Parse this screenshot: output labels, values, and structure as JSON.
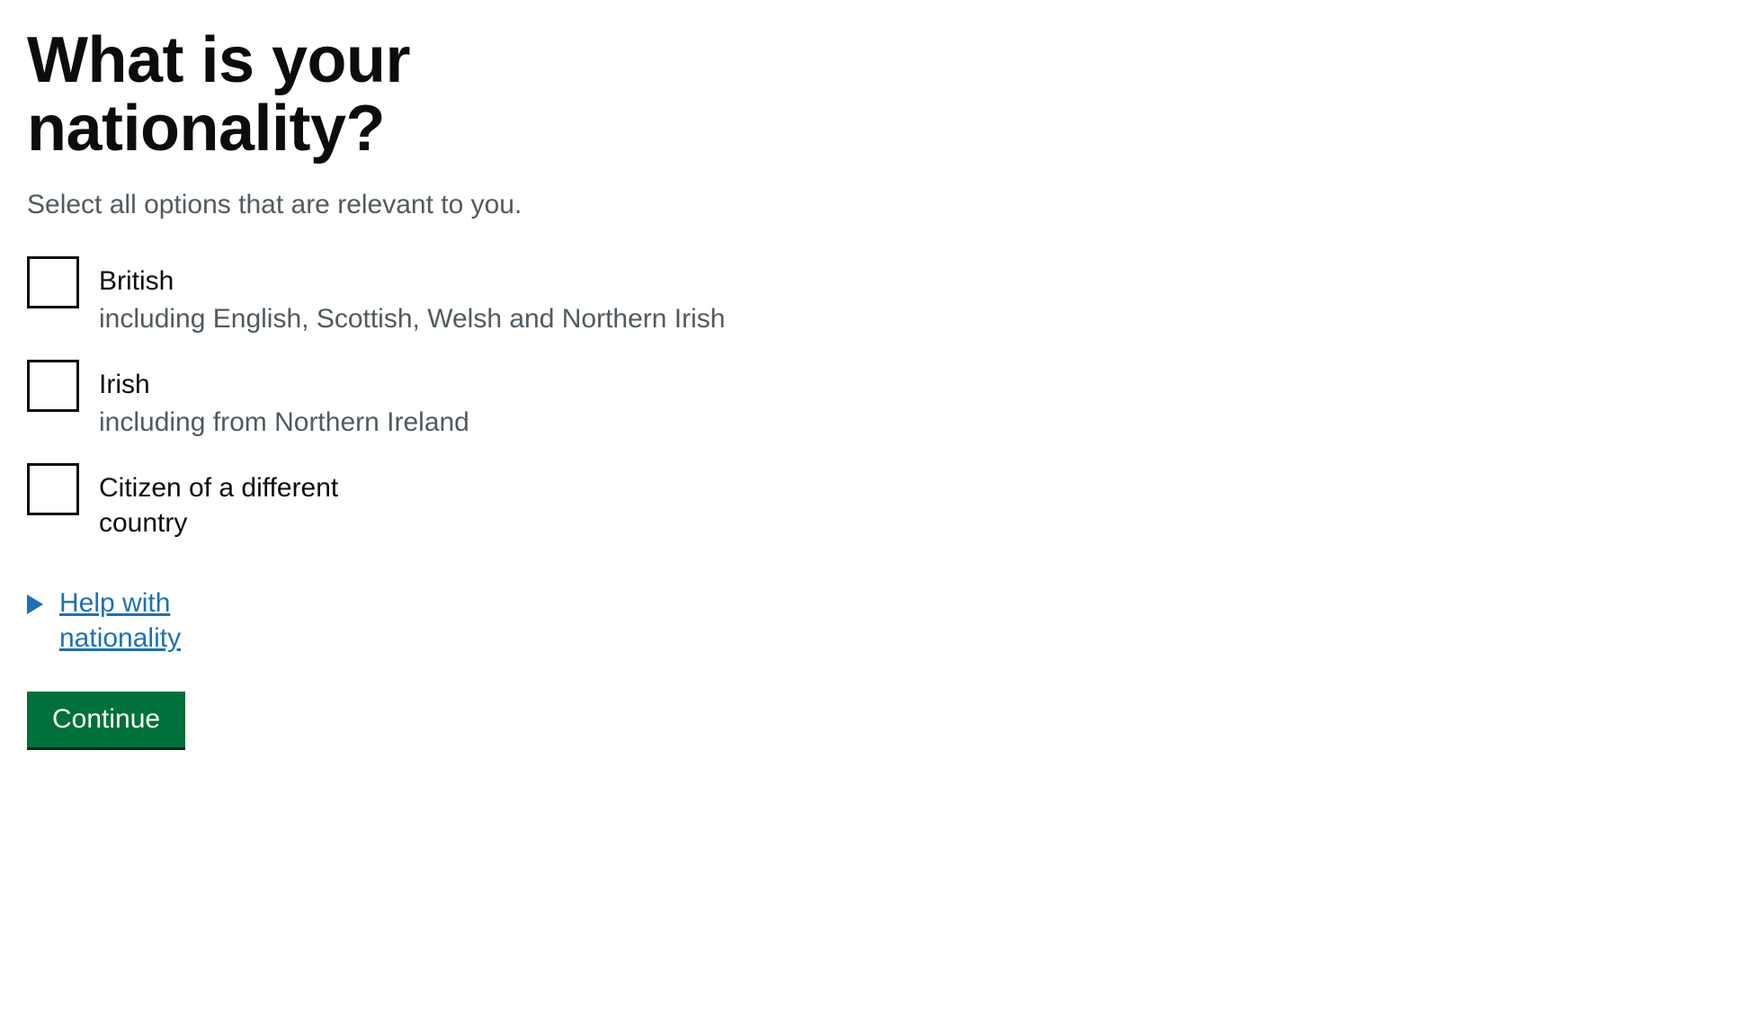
{
  "heading": "What is your nationality?",
  "hint": "Select all options that are relevant to you.",
  "options": [
    {
      "label": "British",
      "hint": "including English, Scottish, Welsh and Northern Irish"
    },
    {
      "label": "Irish",
      "hint": "including from Northern Ireland"
    },
    {
      "label": "Citizen of a different country",
      "hint": ""
    }
  ],
  "details_summary": "Help with nationality",
  "continue_label": "Continue"
}
